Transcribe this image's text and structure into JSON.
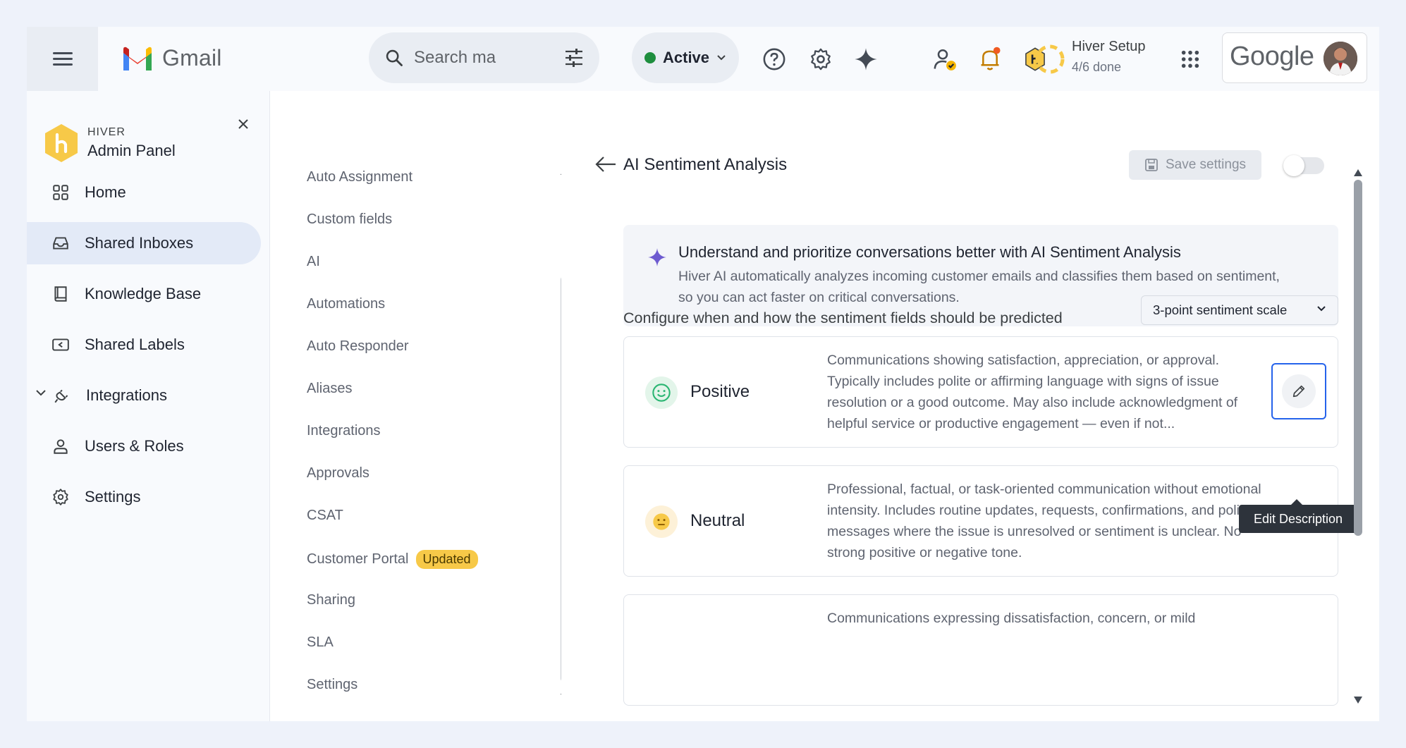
{
  "topbar": {
    "app_name": "Gmail",
    "search_placeholder": "Search ma",
    "status_label": "Active",
    "setup_title": "Hiver Setup",
    "setup_progress": "4/6 done",
    "google_label": "Google"
  },
  "sidebar": {
    "brand_small": "HIVER",
    "brand_title": "Admin Panel",
    "items": [
      {
        "label": "Home",
        "icon": "grid-icon"
      },
      {
        "label": "Shared Inboxes",
        "icon": "inbox-icon",
        "active": true
      },
      {
        "label": "Knowledge Base",
        "icon": "book-icon"
      },
      {
        "label": "Shared Labels",
        "icon": "label-icon"
      },
      {
        "label": "Integrations",
        "icon": "plug-icon"
      },
      {
        "label": "Users & Roles",
        "icon": "user-icon"
      },
      {
        "label": "Settings",
        "icon": "gear-icon"
      }
    ]
  },
  "subnav": {
    "items": [
      {
        "label": "Auto Assignment"
      },
      {
        "label": "Custom fields"
      },
      {
        "label": "AI"
      },
      {
        "label": "Automations"
      },
      {
        "label": "Auto Responder"
      },
      {
        "label": "Aliases"
      },
      {
        "label": "Integrations"
      },
      {
        "label": "Approvals"
      },
      {
        "label": "CSAT"
      },
      {
        "label": "Customer Portal",
        "badge": "Updated"
      },
      {
        "label": "Sharing"
      },
      {
        "label": "SLA"
      },
      {
        "label": "Settings"
      }
    ]
  },
  "main": {
    "title": "AI Sentiment Analysis",
    "save_label": "Save settings",
    "info_title": "Understand and prioritize conversations better with AI Sentiment Analysis",
    "info_body": "Hiver AI automatically analyzes incoming customer emails and classifies them based on sentiment, so you can act faster on critical conversations.",
    "config_label": "Configure when and how the sentiment fields should be predicted",
    "scale_value": "3-point sentiment scale",
    "tooltip": "Edit Description",
    "cards": [
      {
        "name": "Positive",
        "description": "Communications showing satisfaction, appreciation, or approval. Typically includes polite or affirming language with signs of issue resolution or a good outcome. May also include acknowledgment of helpful service or productive engagement — even if not..."
      },
      {
        "name": "Neutral",
        "description": "Professional, factual, or task-oriented communication without emotional intensity. Includes routine updates, requests, confirmations, and polite messages where the issue is unresolved or sentiment is unclear. No strong positive or negative tone."
      },
      {
        "name": "",
        "description": "Communications expressing dissatisfaction, concern, or mild"
      }
    ]
  },
  "colors": {
    "accent": "#2563eb",
    "active_nav": "#e3eaf7",
    "badge": "#f7c948",
    "status_green": "#1e8e3e"
  }
}
